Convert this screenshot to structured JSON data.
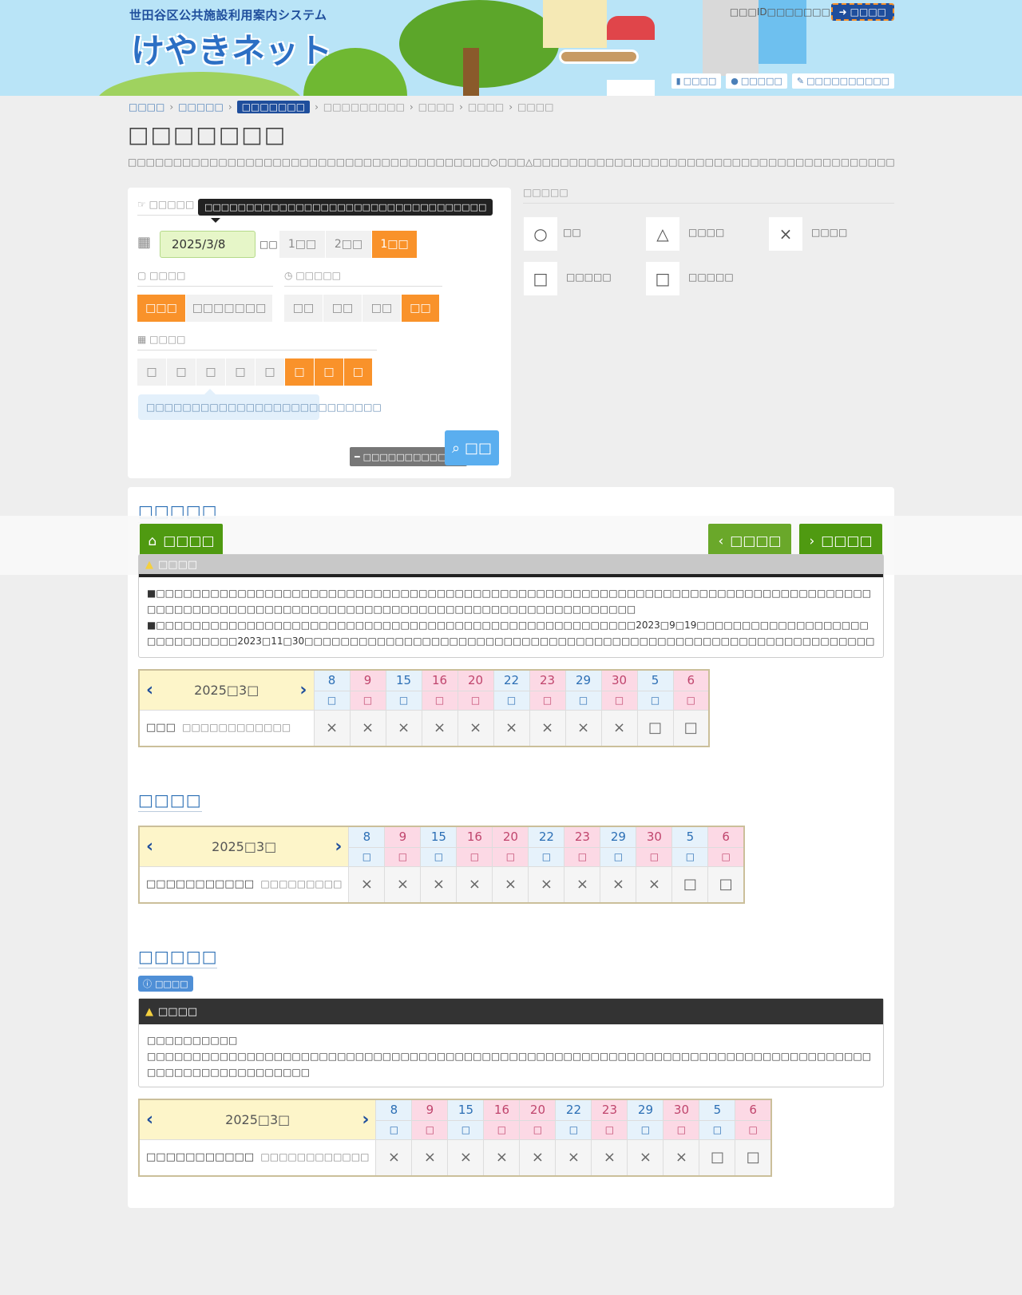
{
  "header": {
    "system_name": "世田谷区公共施設利用案内システム",
    "logo_text": "けやきネット",
    "login_prompt": "□□□ID□□□□□□□",
    "login_button": "□□□□",
    "links": [
      "□□□□",
      "□□□□□",
      "□□□□□□□□□□"
    ]
  },
  "breadcrumb": [
    "□□□□",
    "□□□□□",
    "□□□□□□□",
    "□□□□□□□□□",
    "□□□□",
    "□□□□",
    "□□□□"
  ],
  "page": {
    "title": "□□□□□□□",
    "description": "□□□□□□□□□□□□□□□□□□□□□□□□□□□□□□□□□□□□□□□□○□□□△□□□□□□□□□□□□□□□□□□□□□□□□□□□□□□□□□□□□□□□□"
  },
  "search": {
    "section_label": "□□□□□",
    "tooltip": "□□□□□□□□□□□□□□□□□□□□□□□□□□□□□□□□□□",
    "date_value": "2025/3/8",
    "date_suffix": "□□",
    "period_options": [
      "1□□",
      "2□□",
      "1□□"
    ],
    "period_selected": 2,
    "usage_label": "□□□□",
    "usage_options": [
      "□□□",
      "□□□□□□□"
    ],
    "usage_selected": 0,
    "time_label": "□□□□□",
    "time_options": [
      "□□",
      "□□",
      "□□",
      "□□"
    ],
    "time_selected": 3,
    "weekday_label": "□□□□",
    "weekdays": [
      "□",
      "□",
      "□",
      "□",
      "□",
      "□",
      "□",
      "□"
    ],
    "weekdays_selected": [
      5,
      6,
      7
    ],
    "hint": "□□□□□□□□□□□□□□□□□□□□□□□□□□",
    "collapse_button": "□□□□□□□□□□□□",
    "search_button": "□□"
  },
  "legend": {
    "title": "□□□□□",
    "items": [
      {
        "symbol": "○",
        "label": "□□"
      },
      {
        "symbol": "△",
        "label": "□□□□"
      },
      {
        "symbol": "×",
        "label": "□□□□"
      },
      {
        "symbol": "□",
        "label": "□□□□□"
      },
      {
        "symbol": "□",
        "label": "□□□□□"
      }
    ]
  },
  "nav": {
    "home": "□□□□",
    "prev": "□□□□",
    "next": "□□□□"
  },
  "facilities": [
    {
      "title": "□□□□□",
      "info_badge": "",
      "notice_title": "□□□□",
      "notice_lines": [
        "■□□□□□□□□□□□□□□□□□□□□□□□□□□□□□□□□□□□□□□□□□□□□□□□□□□□□□□□□□□□□□□□□□□□□□□□□□□□□□□□□□□□□□□□□□□□□□□□□□□□□□□□□□□□□□□□□□□□□□□□□□□□□□□□□□□□□□",
        "■□□□□□□□□□□□□□□□□□□□□□□□□□□□□□□□□□□□□□□□□□□□□□□□□□□□□□2023□9□19□□□□□□□□□□□□□□□□□□□□□□□□□□□□□2023□11□30□□□□□□□□□□□□□□□□□□□□□□□□□□□□□□□□□□□□□□□□□□□□□□□□□□□□□□□□□□□□□□□□□□□□□□□□□□□□□□□□"
      ],
      "month": "2025□3□",
      "room": "□□□",
      "room_sub": "□□□□□□□□□□□□",
      "cells": [
        "×",
        "×",
        "×",
        "×",
        "×",
        "×",
        "×",
        "×",
        "×",
        "□",
        "□"
      ]
    },
    {
      "title": "□□□□",
      "info_badge": "",
      "notice_title": "",
      "notice_lines": [],
      "month": "2025□3□",
      "room": "□□□□□□□□□□□",
      "room_sub": "□□□□□□□□□",
      "cells": [
        "×",
        "×",
        "×",
        "×",
        "×",
        "×",
        "×",
        "×",
        "×",
        "□",
        "□"
      ]
    },
    {
      "title": "□□□□□",
      "info_badge": "□□□□",
      "notice_title": "□□□□",
      "notice_lines": [
        "□□□□□□□□□□",
        "□□□□□□□□□□□□□□□□□□□□□□□□□□□□□□□□□□□□□□□□□□□□□□□□□□□□□□□□□□□□□□□□□□□□□□□□□□□□□□□□□□□□□□□□□□□□□□□□□□"
      ],
      "month": "2025□3□",
      "room": "□□□□□□□□□□□",
      "room_sub": "□□□□□□□□□□□□",
      "cells": [
        "×",
        "×",
        "×",
        "×",
        "×",
        "×",
        "×",
        "×",
        "×",
        "□",
        "□"
      ]
    }
  ],
  "calendar_days": [
    {
      "day": "8",
      "wd": "□",
      "kind": "sat"
    },
    {
      "day": "9",
      "wd": "□",
      "kind": "sun"
    },
    {
      "day": "15",
      "wd": "□",
      "kind": "sat"
    },
    {
      "day": "16",
      "wd": "□",
      "kind": "sun"
    },
    {
      "day": "20",
      "wd": "□",
      "kind": "sun"
    },
    {
      "day": "22",
      "wd": "□",
      "kind": "sat"
    },
    {
      "day": "23",
      "wd": "□",
      "kind": "sun"
    },
    {
      "day": "29",
      "wd": "□",
      "kind": "sat"
    },
    {
      "day": "30",
      "wd": "□",
      "kind": "sun"
    },
    {
      "day": "5",
      "wd": "□",
      "kind": "sat"
    },
    {
      "day": "6",
      "wd": "□",
      "kind": "sun"
    }
  ],
  "colors": {
    "orange": "#f9922a",
    "green": "#4f9a11",
    "navy": "#1f4e9c",
    "sat_bg": "#e6f2fb",
    "sun_bg": "#fcd9e5",
    "month_bg": "#fdf5c9"
  }
}
